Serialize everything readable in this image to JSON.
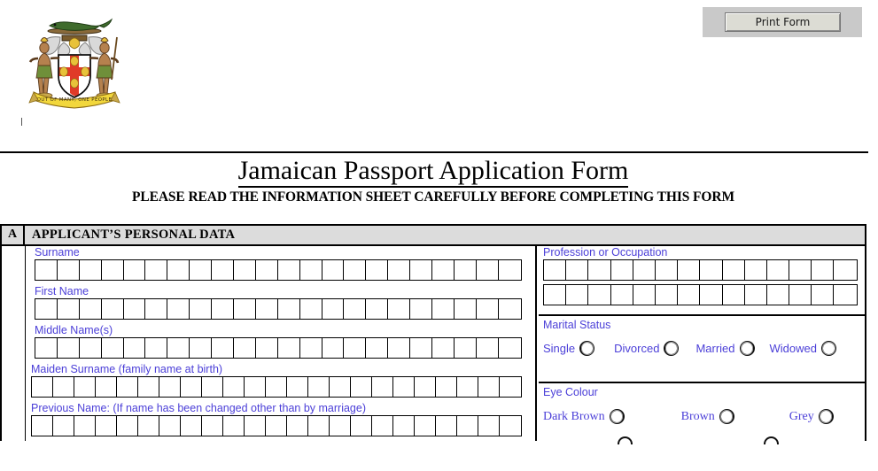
{
  "toolbar": {
    "print_label": "Print Form"
  },
  "header": {
    "emblem_name": "Jamaica Coat of Arms",
    "title": "Jamaican Passport Application Form",
    "subtitle": "PLEASE READ THE INFORMATION SHEET CAREFULLY BEFORE COMPLETING THIS FORM"
  },
  "section_a": {
    "letter": "A",
    "title": "APPLICANT’S PERSONAL DATA",
    "left_fields": [
      {
        "label": "Surname",
        "boxes": 22,
        "value": ""
      },
      {
        "label": "First Name",
        "boxes": 22,
        "value": ""
      },
      {
        "label": "Middle Name(s)",
        "boxes": 22,
        "value": ""
      },
      {
        "label": "Maiden Surname (family name at birth)",
        "boxes": 23,
        "value": ""
      },
      {
        "label": "Previous Name:  (If name has been changed other than by marriage)",
        "boxes": 23,
        "value": ""
      }
    ],
    "profession": {
      "label": "Profession or Occupation",
      "rows": [
        {
          "boxes": 14,
          "value": ""
        },
        {
          "boxes": 14,
          "value": ""
        }
      ]
    },
    "marital_status": {
      "label": "Marital Status",
      "options": [
        {
          "label": "Single",
          "selected": false
        },
        {
          "label": "Divorced",
          "selected": false
        },
        {
          "label": "Married",
          "selected": false
        },
        {
          "label": "Widowed",
          "selected": false
        }
      ]
    },
    "eye_colour": {
      "label": "Eye Colour",
      "options": [
        {
          "label": "Dark Brown",
          "selected": false
        },
        {
          "label": "Brown",
          "selected": false
        },
        {
          "label": "Grey",
          "selected": false
        }
      ]
    }
  },
  "colors": {
    "label_blue": "#4b3fd8",
    "section_header_bg": "#dcdcdc",
    "print_bar_bg": "#c9c9c9"
  }
}
